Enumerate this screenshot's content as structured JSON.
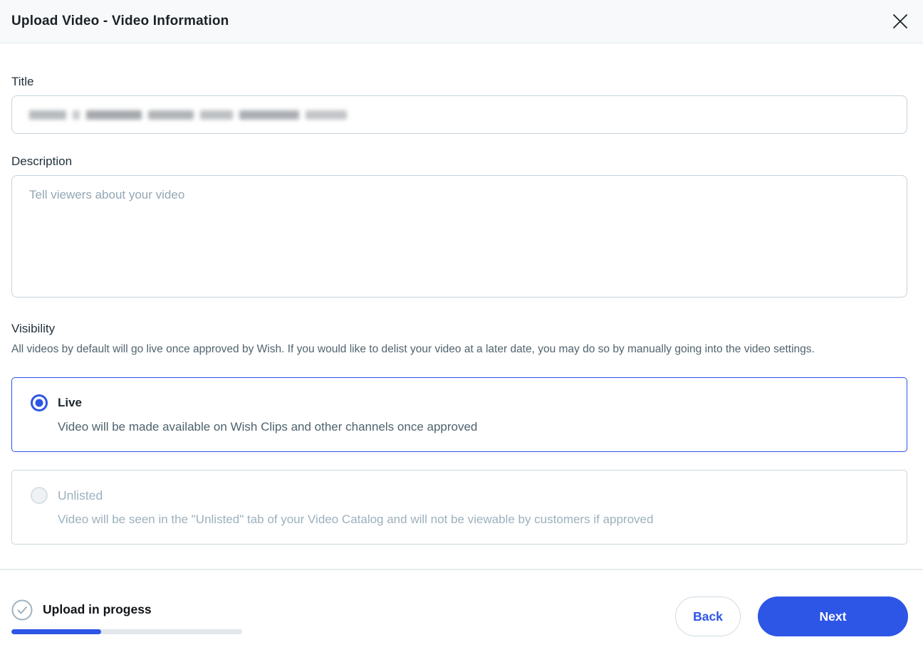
{
  "header": {
    "title": "Upload Video - Video Information",
    "close_icon": "close-icon"
  },
  "form": {
    "title_field": {
      "label": "Title",
      "value_blurred": true
    },
    "description_field": {
      "label": "Description",
      "placeholder": "Tell viewers about your video",
      "value": ""
    },
    "visibility": {
      "label": "Visibility",
      "help_text": "All videos by default will go live once approved by Wish. If you would like to delist your video at a later date, you may do so by manually going into the video settings.",
      "options": [
        {
          "label": "Live",
          "description": "Video will be made available on Wish Clips and other channels once approved",
          "selected": true,
          "disabled": false
        },
        {
          "label": "Unlisted",
          "description": "Video will be seen in the \"Unlisted\" tab of your Video Catalog and will not be viewable by customers if approved",
          "selected": false,
          "disabled": true
        }
      ]
    }
  },
  "footer": {
    "status_label": "Upload in progess",
    "progress_percent": 39,
    "back_label": "Back",
    "next_label": "Next"
  },
  "colors": {
    "accent_blue": "#2d55e6",
    "dark_text": "#1a2127",
    "body_text": "#51646e",
    "muted_text": "#9cb0bd",
    "input_border": "#c6d3dc",
    "header_bg": "#f7f9fa"
  }
}
